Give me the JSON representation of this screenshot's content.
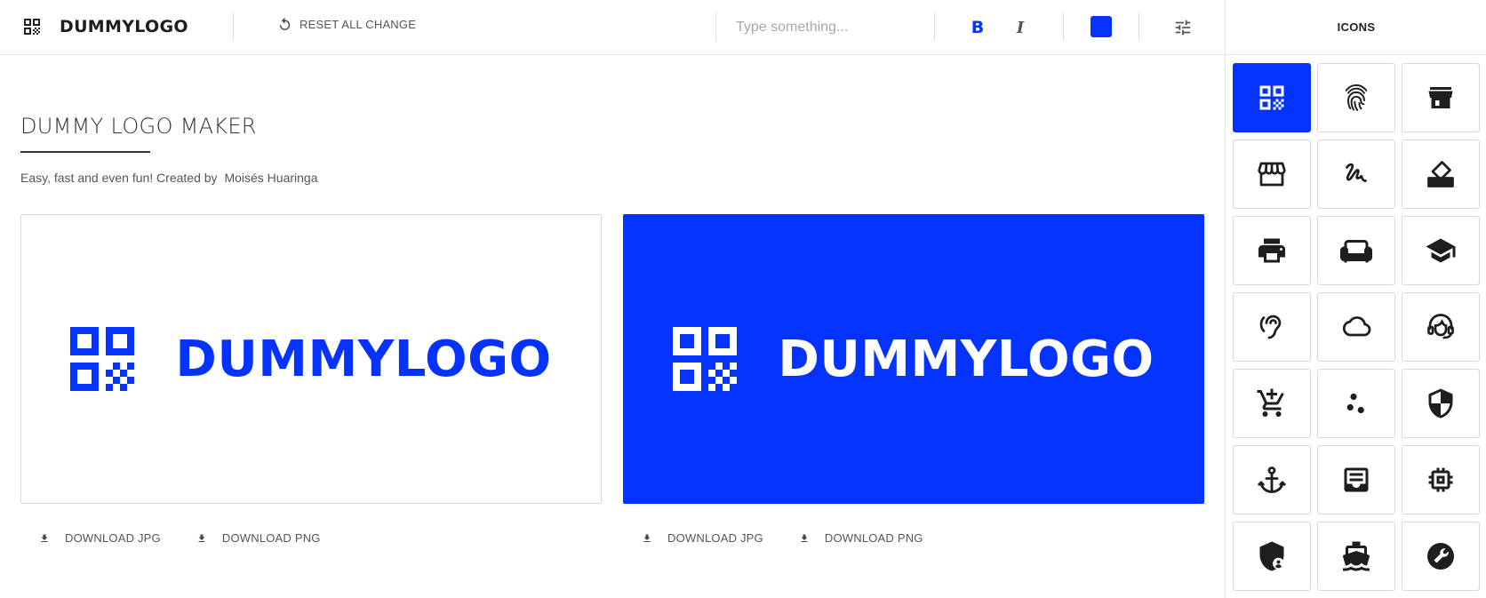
{
  "header": {
    "brand_name": "DUMMYLOGO",
    "reset_label": "RESET ALL CHANGE",
    "search_placeholder": "Type something...",
    "bold_label": "B",
    "italic_label": "I",
    "selected_color": "#0432ff",
    "settings_icon": "tune-icon"
  },
  "sidebar": {
    "title": "ICONS",
    "icons": [
      "qr-code-icon",
      "fingerprint-icon",
      "storefront-icon",
      "store-awning-icon",
      "gesture-icon",
      "eraser-icon",
      "printer-icon",
      "sofa-icon",
      "graduation-cap-icon",
      "hearing-icon",
      "cloud-icon",
      "support-agent-icon",
      "add-cart-icon",
      "scatter-dots-icon",
      "shield-icon",
      "anchor-icon",
      "inbox-tray-icon",
      "cpu-chip-icon",
      "admin-shield-icon",
      "ship-icon",
      "wrench-icon"
    ],
    "selected_index": 0
  },
  "main": {
    "title": "DUMMY LOGO MAKER",
    "subtitle": "Easy, fast and even fun! Created by",
    "author": "Moisés Huaringa",
    "logo_text": "DUMMYLOGO",
    "colors": {
      "accent": "#0432ff",
      "light_bg": "#ffffff",
      "dark_text": "#ffffff"
    },
    "download_jpg": "DOWNLOAD JPG",
    "download_png": "DOWNLOAD PNG"
  }
}
